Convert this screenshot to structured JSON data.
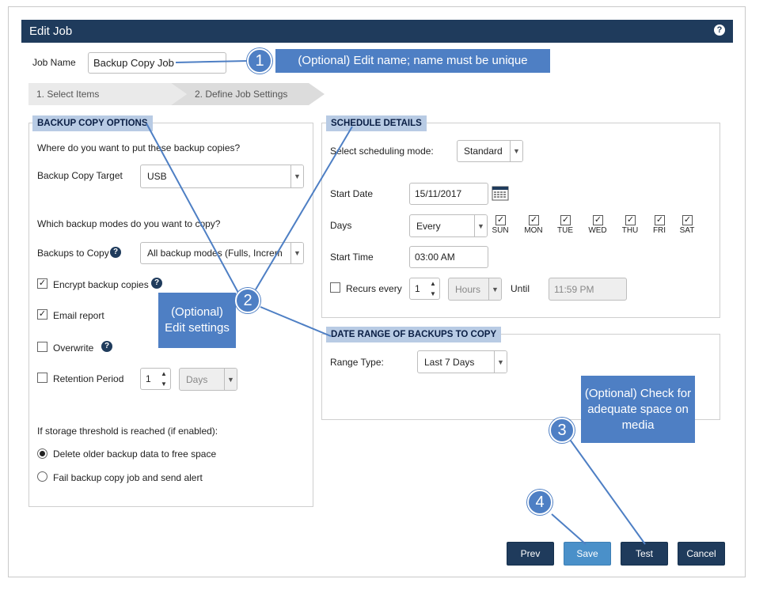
{
  "window": {
    "title": "Edit Job",
    "help": "?"
  },
  "job_name": {
    "label": "Job Name",
    "value": "Backup Copy Job"
  },
  "wizard": {
    "steps": [
      "1. Select Items",
      "2. Define Job Settings"
    ]
  },
  "backup_copy_options": {
    "title": "BACKUP COPY OPTIONS",
    "target_question": "Where do you want to put these backup copies?",
    "target_label": "Backup Copy Target",
    "target_value": "USB",
    "modes_question": "Which backup modes do you want to copy?",
    "backups_to_copy_label": "Backups to Copy",
    "backups_to_copy_value": "All backup modes (Fulls, Increm",
    "encrypt_label": "Encrypt backup copies",
    "email_label": "Email report",
    "overwrite_label": "Overwrite",
    "retention_label": "Retention Period",
    "retention_value": "1",
    "retention_unit": "Days",
    "threshold_question": "If storage threshold is reached (if enabled):",
    "radio_delete": "Delete older backup data to free space",
    "radio_fail": "Fail backup copy job and send alert"
  },
  "schedule": {
    "title": "SCHEDULE DETAILS",
    "mode_label": "Select scheduling mode:",
    "mode_value": "Standard",
    "start_date_label": "Start Date",
    "start_date_value": "15/11/2017",
    "days_label": "Days",
    "days_value": "Every",
    "days": [
      "SUN",
      "MON",
      "TUE",
      "WED",
      "THU",
      "FRI",
      "SAT"
    ],
    "start_time_label": "Start Time",
    "start_time_value": "03:00 AM",
    "recurs_label": "Recurs every",
    "recurs_value": "1",
    "recurs_unit": "Hours",
    "until_label": "Until",
    "until_value": "11:59 PM"
  },
  "date_range": {
    "title": "DATE RANGE OF BACKUPS TO COPY",
    "range_label": "Range Type:",
    "range_value": "Last 7 Days"
  },
  "buttons": {
    "prev": "Prev",
    "save": "Save",
    "test": "Test",
    "cancel": "Cancel"
  },
  "annotations": {
    "callout1": "(Optional) Edit name;  name must be unique",
    "callout2": "(Optional) Edit settings",
    "callout3": "(Optional) Check for adequate space on media",
    "badges": [
      "1",
      "2",
      "3",
      "4"
    ]
  },
  "colors": {
    "header": "#1f3b5c",
    "accent": "#4e7fc4",
    "section": "#b8cbe4"
  }
}
